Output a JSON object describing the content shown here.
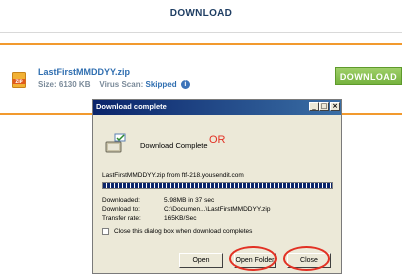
{
  "header": {
    "title": "DOWNLOAD"
  },
  "file": {
    "name": "LastFirstMMDDYY.zip",
    "size_label": "Size:",
    "size_value": "6130 KB",
    "scan_label": "Virus Scan:",
    "scan_value": "Skipped",
    "download_button": "DOWNLOAD"
  },
  "dialog": {
    "title": "Download complete",
    "heading": "Download Complete",
    "source": "LastFirstMMDDYY.zip from ftf-218.yousendit.com",
    "progress_percent": 100,
    "stats": [
      {
        "label": "Downloaded:",
        "value": "5.98MB in 37 sec"
      },
      {
        "label": "Download to:",
        "value": "C:\\Documen...\\LastFirstMMDDYY.zip"
      },
      {
        "label": "Transfer rate:",
        "value": "165KB/Sec"
      }
    ],
    "checkbox_label": "Close this dialog box when download completes",
    "checkbox_checked": false,
    "buttons": {
      "open": "Open",
      "open_folder": "Open Folder",
      "close": "Close"
    },
    "window_controls": {
      "minimize": "_",
      "maximize": "□",
      "close": "×"
    }
  },
  "annotation": {
    "or_text": "OR",
    "color": "#e23124"
  },
  "colors": {
    "accent_orange": "#f29a2e",
    "download_green": "#76b33e",
    "title_bar": "#0a246a"
  }
}
